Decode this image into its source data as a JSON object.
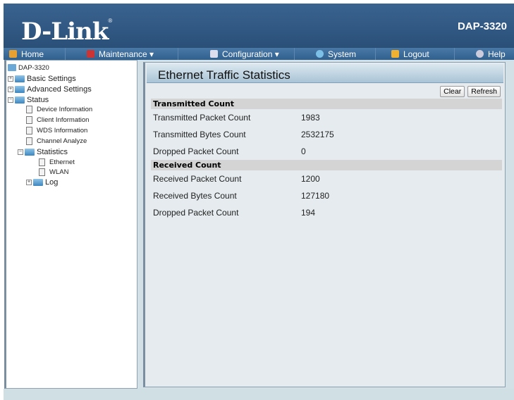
{
  "header": {
    "logo": "D-Link",
    "model": "DAP-3320"
  },
  "menu": [
    {
      "label": "Home",
      "icon": "home-icon"
    },
    {
      "label": "Maintenance ▾",
      "icon": "tools-icon"
    },
    {
      "label": "Configuration ▾",
      "icon": "save-icon"
    },
    {
      "label": "System",
      "icon": "globe-icon"
    },
    {
      "label": "Logout",
      "icon": "key-icon"
    },
    {
      "label": "Help",
      "icon": "help-icon"
    }
  ],
  "tree": {
    "root": "DAP-3320",
    "basic": "Basic Settings",
    "advanced": "Advanced Settings",
    "status": "Status",
    "device": "Device Information",
    "client": "Client Information",
    "wds": "WDS Information",
    "channel": "Channel Analyze",
    "statistics": "Statistics",
    "ethernet": "Ethernet",
    "wlan": "WLAN",
    "log": "Log"
  },
  "main": {
    "title": "Ethernet Traffic Statistics",
    "clear": "Clear",
    "refresh": "Refresh",
    "tx": {
      "heading": "Transmitted Count",
      "rows": [
        {
          "label": "Transmitted Packet Count",
          "value": "1983"
        },
        {
          "label": "Transmitted Bytes Count",
          "value": "2532175"
        },
        {
          "label": "Dropped Packet Count",
          "value": "0"
        }
      ]
    },
    "rx": {
      "heading": "Received Count",
      "rows": [
        {
          "label": "Received Packet Count",
          "value": "1200"
        },
        {
          "label": "Received Bytes Count",
          "value": "127180"
        },
        {
          "label": "Dropped Packet Count",
          "value": "194"
        }
      ]
    }
  }
}
